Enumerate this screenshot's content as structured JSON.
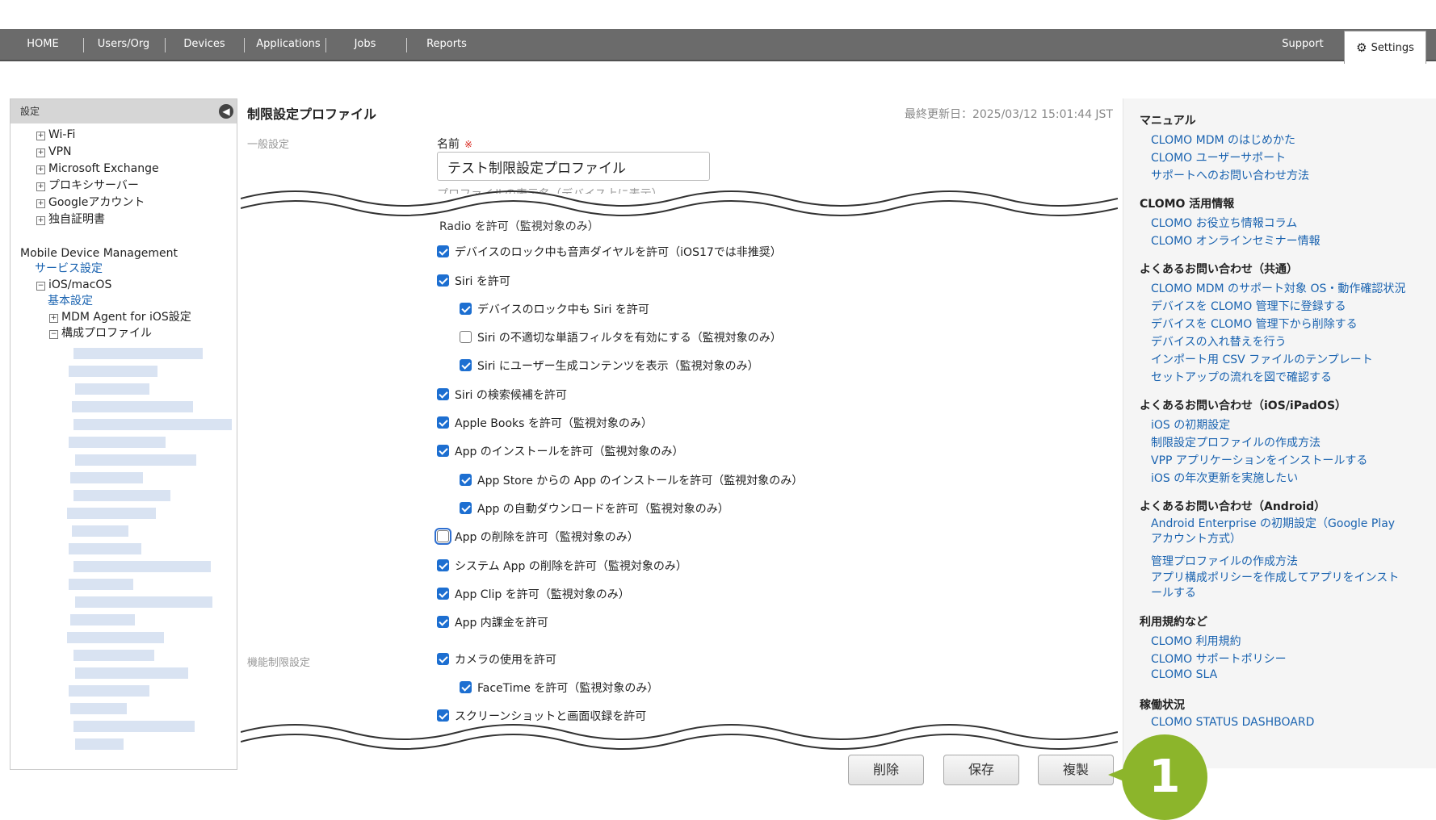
{
  "nav": {
    "items": [
      "HOME",
      "Users/Org",
      "Devices",
      "Applications",
      "Jobs",
      "Reports"
    ],
    "support": "Support",
    "settings": "Settings"
  },
  "sidebar": {
    "title": "設定",
    "top_items": [
      "Wi-Fi",
      "VPN",
      "Microsoft Exchange",
      "プロキシサーバー",
      "Googleアカウント",
      "独自証明書"
    ],
    "mdm_title": "Mobile Device Management",
    "service_settings": "サービス設定",
    "ios_macos": "iOS/macOS",
    "basic_settings": "基本設定",
    "mdm_agent": "MDM Agent for iOS設定",
    "config_profiles": "構成プロファイル"
  },
  "main": {
    "title": "制限設定プロファイル",
    "updated": "最終更新日：2025/03/12 15:01:44 JST",
    "section_general": "一般設定",
    "name_label": "名前",
    "required_mark": "※",
    "name_value": "テスト制限設定プロファイル",
    "name_helper": "プロファイルの表示名（デバイス上に表示）",
    "cut_text": "Radio を許可（監視対象のみ）",
    "section_feature": "機能制限設定",
    "checkboxes": [
      {
        "label": "デバイスのロック中も音声ダイヤルを許可（iOS17では非推奨）",
        "checked": true
      },
      {
        "label": "Siri を許可",
        "checked": true
      },
      {
        "label": "デバイスのロック中も Siri を許可",
        "checked": true
      },
      {
        "label": "Siri の不適切な単語フィルタを有効にする（監視対象のみ）",
        "checked": false
      },
      {
        "label": "Siri にユーザー生成コンテンツを表示（監視対象のみ）",
        "checked": true
      },
      {
        "label": "Siri の検索候補を許可",
        "checked": true
      },
      {
        "label": "Apple Books を許可（監視対象のみ）",
        "checked": true
      },
      {
        "label": "App のインストールを許可（監視対象のみ）",
        "checked": true
      },
      {
        "label": "App Store からの App のインストールを許可（監視対象のみ）",
        "checked": true
      },
      {
        "label": "App の自動ダウンロードを許可（監視対象のみ）",
        "checked": true
      },
      {
        "label": "App の削除を許可（監視対象のみ）",
        "checked": false
      },
      {
        "label": "システム App の削除を許可（監視対象のみ）",
        "checked": true
      },
      {
        "label": "App Clip を許可（監視対象のみ）",
        "checked": true
      },
      {
        "label": "App 内課金を許可",
        "checked": true
      },
      {
        "label": "カメラの使用を許可",
        "checked": true
      },
      {
        "label": "FaceTime を許可（監視対象のみ）",
        "checked": true
      },
      {
        "label": "スクリーンショットと画面収録を許可",
        "checked": true
      }
    ],
    "buttons": {
      "delete": "削除",
      "save": "保存",
      "duplicate": "複製"
    },
    "badge": "1"
  },
  "help": {
    "sections": [
      {
        "title": "マニュアル",
        "links": [
          "CLOMO MDM のはじめかた",
          "CLOMO ユーザーサポート",
          "サポートへのお問い合わせ方法"
        ]
      },
      {
        "title": "CLOMO 活用情報",
        "links": [
          "CLOMO お役立ち情報コラム",
          "CLOMO オンラインセミナー情報"
        ]
      },
      {
        "title": "よくあるお問い合わせ（共通）",
        "links": [
          "CLOMO MDM のサポート対象 OS・動作確認状況",
          "デバイスを CLOMO 管理下に登録する",
          "デバイスを CLOMO 管理下から削除する",
          "デバイスの入れ替えを行う",
          "インポート用 CSV ファイルのテンプレート",
          "セットアップの流れを図で確認する"
        ]
      },
      {
        "title": "よくあるお問い合わせ（iOS/iPadOS）",
        "links": [
          "iOS の初期設定",
          "制限設定プロファイルの作成方法",
          "VPP アプリケーションをインストールする",
          "iOS の年次更新を実施したい"
        ]
      },
      {
        "title": "よくあるお問い合わせ（Android）",
        "links": [
          "Android Enterprise の初期設定（Google Play アカウント方式）",
          "管理プロファイルの作成方法",
          "アプリ構成ポリシーを作成してアプリをインストールする"
        ]
      },
      {
        "title": "利用規約など",
        "links": [
          "CLOMO 利用規約",
          "CLOMO サポートポリシー",
          "CLOMO SLA"
        ]
      },
      {
        "title": "稼働状況",
        "links": [
          "CLOMO STATUS DASHBOARD"
        ]
      }
    ]
  }
}
